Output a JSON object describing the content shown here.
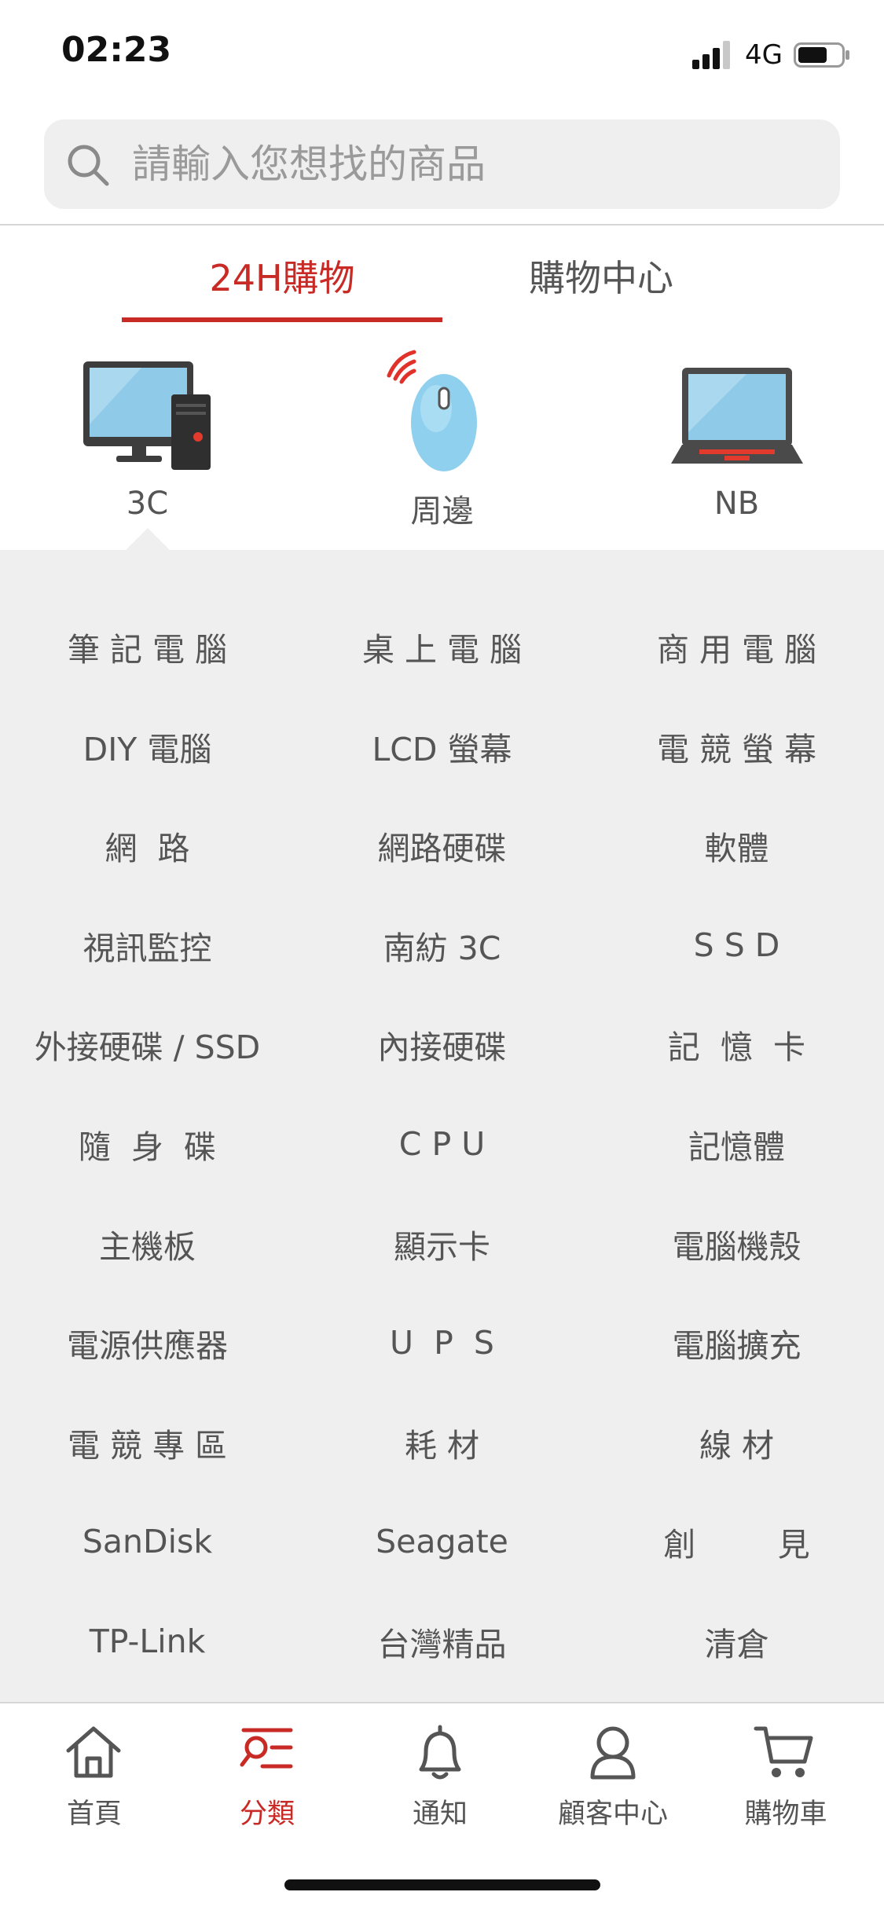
{
  "status_bar": {
    "time": "02:23",
    "network": "4G",
    "icons": [
      "signal-icon",
      "battery-icon"
    ]
  },
  "search": {
    "placeholder": "請輸入您想找的商品",
    "icon": "search-icon"
  },
  "tabs": [
    {
      "label": "24H購物",
      "active": true
    },
    {
      "label": "購物中心",
      "active": false
    }
  ],
  "categories": [
    {
      "label": "3C",
      "icon": "desktop-computer-icon",
      "selected": true
    },
    {
      "label": "周邊",
      "icon": "wireless-mouse-icon",
      "selected": false
    },
    {
      "label": "NB",
      "icon": "laptop-icon",
      "selected": false
    }
  ],
  "grid_items": [
    "筆 記 電 腦",
    "桌 上 電 腦",
    "商 用 電 腦",
    "DIY 電腦",
    "LCD 螢幕",
    "電 競 螢 幕",
    "網  路",
    "網路硬碟",
    "軟體",
    "視訊監控",
    "南紡 3C",
    "S S D",
    "外接硬碟 / SSD",
    "內接硬碟",
    "記  憶  卡",
    "隨  身  碟",
    "C P U",
    "記憶體",
    "主機板",
    "顯示卡",
    "電腦機殼",
    "電源供應器",
    "U  P  S",
    "電腦擴充",
    "電 競 專 區",
    "耗 材",
    "線 材",
    "SanDisk",
    "Seagate",
    "創        見",
    "TP-Link",
    "台灣精品",
    "清倉"
  ],
  "bottom_nav": [
    {
      "label": "首頁",
      "icon": "home-icon",
      "active": false
    },
    {
      "label": "分類",
      "icon": "category-icon",
      "active": true
    },
    {
      "label": "通知",
      "icon": "bell-icon",
      "active": false
    },
    {
      "label": "顧客中心",
      "icon": "user-icon",
      "active": false
    },
    {
      "label": "購物車",
      "icon": "cart-icon",
      "active": false
    }
  ],
  "colors": {
    "accent": "#c82a25",
    "panel_bg": "#efefef",
    "text": "#555555"
  }
}
